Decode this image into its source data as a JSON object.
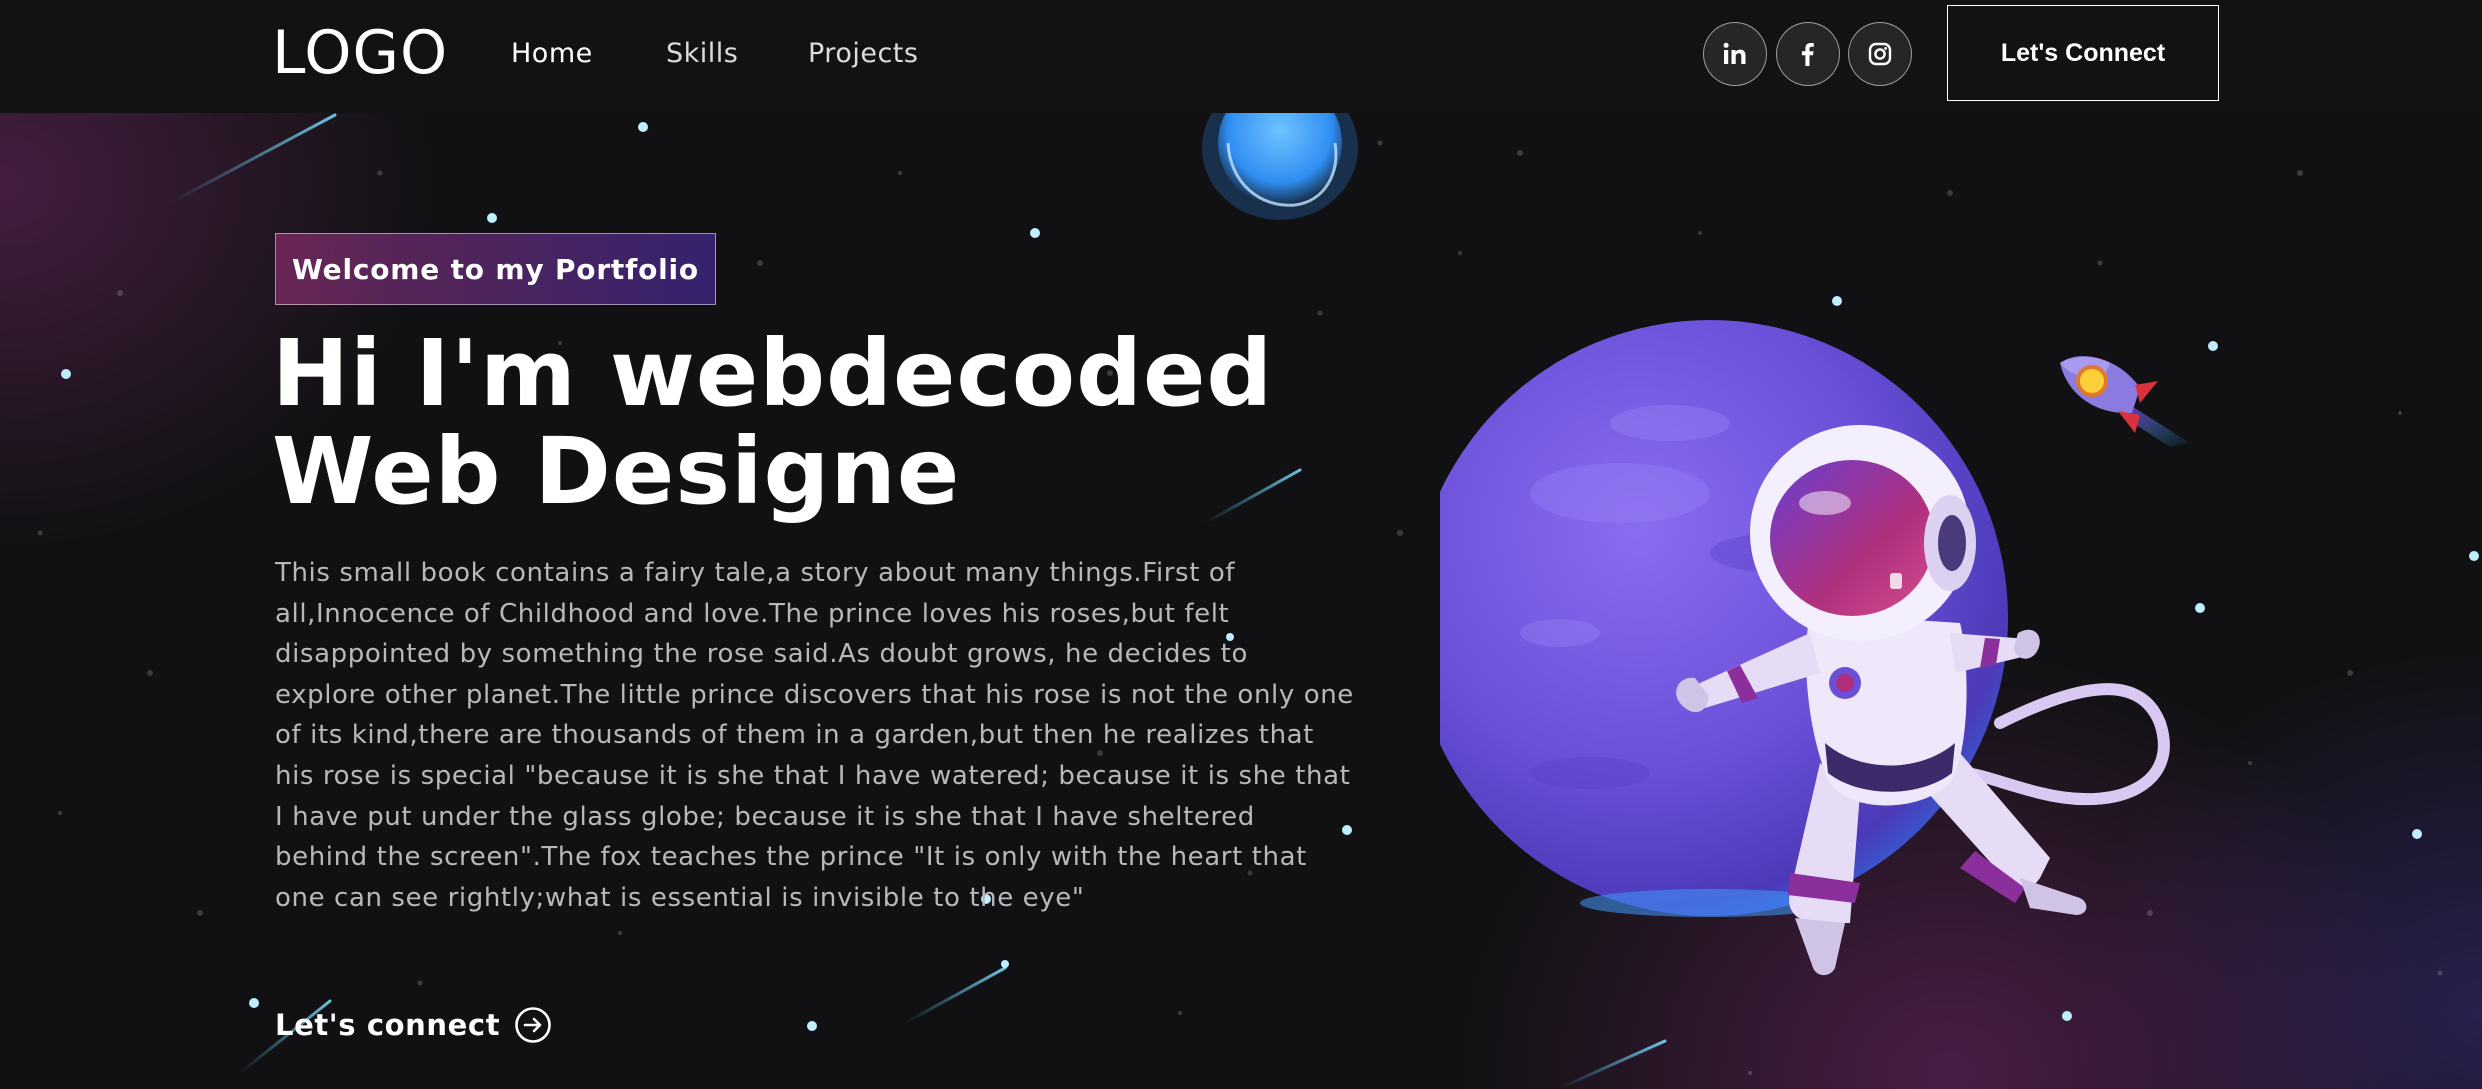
{
  "navbar": {
    "logo": "LOGO",
    "links": [
      "Home",
      "Skills",
      "Projects"
    ],
    "social_icons": [
      "linkedin-icon",
      "facebook-icon",
      "instagram-icon"
    ],
    "connect_label": "Let's Connect"
  },
  "banner": {
    "tagline": "Welcome to my Portfolio",
    "headline_line1": "Hi I'm webdecoded",
    "headline_line2": "Web Designe",
    "bio": "This small book contains a fairy tale,a story about many things.First of all,Innocence of Childhood and love.The prince loves his roses,but felt disappointed by something the rose said.As doubt grows, he decides to explore other planet.The little prince discovers that his rose is not the only one of its kind,there are thousands of them in a garden,but then he realizes that his rose is special \"because it is she that I have watered; because it is she that I have put under the glass globe; because it is she that I have sheltered behind the screen\".The fox teaches the prince \"It is only with the heart that one can see rightly;what is essential is invisible to the eye\"",
    "cta_label": "Let's connect",
    "cta_icon": "arrow-right-circle-icon",
    "illustration": "astronaut-planet-illustration",
    "decorations": [
      "rocket-icon",
      "blue-moon-icon",
      "stars",
      "shooting-stars"
    ]
  },
  "colors": {
    "background": "#121212",
    "accent_pink": "#AA367C",
    "accent_purple": "#4A2FBD",
    "text": "#FFFFFF",
    "text_muted": "#B8B8B8"
  }
}
